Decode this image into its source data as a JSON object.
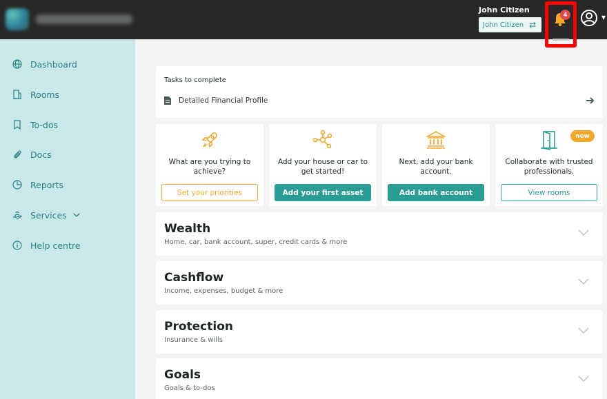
{
  "header": {
    "user_name": "John Citizen",
    "switcher_label": "John Citizen",
    "switch_icon": "⇄",
    "notification_count": "4"
  },
  "sidebar": {
    "items": [
      {
        "label": "Dashboard",
        "icon": "globe-icon"
      },
      {
        "label": "Rooms",
        "icon": "building-icon"
      },
      {
        "label": "To-dos",
        "icon": "bookmark-icon"
      },
      {
        "label": "Docs",
        "icon": "paperclip-icon"
      },
      {
        "label": "Reports",
        "icon": "pie-chart-icon"
      },
      {
        "label": "Services",
        "icon": "hand-icon"
      },
      {
        "label": "Help centre",
        "icon": "info-icon"
      }
    ]
  },
  "tasks": {
    "title": "Tasks to complete",
    "items": [
      {
        "label": "Detailed Financial Profile"
      }
    ]
  },
  "actions": [
    {
      "description": "What are you trying to achieve?",
      "button": "Set your priorities",
      "icon": "rocket-icon"
    },
    {
      "description": "Add your house or car to get started!",
      "button": "Add your first asset",
      "icon": "network-icon"
    },
    {
      "description": "Next, add your bank account.",
      "button": "Add bank account",
      "icon": "bank-icon"
    },
    {
      "description": "Collaborate with trusted professionals.",
      "button": "View rooms",
      "icon": "door-icon",
      "badge": "new"
    }
  ],
  "sections": [
    {
      "title": "Wealth",
      "subtitle": "Home, car, bank account, super, credit cards & more"
    },
    {
      "title": "Cashflow",
      "subtitle": "Income, expenses, budget & more"
    },
    {
      "title": "Protection",
      "subtitle": "Insurance & wills"
    },
    {
      "title": "Goals",
      "subtitle": "Goals & to-dos"
    }
  ],
  "colors": {
    "topbar": "#282828",
    "sidebar": "#c9e9e8",
    "teal": "#2a9d94",
    "orange": "#f2a82b",
    "highlight": "#ff0000"
  }
}
